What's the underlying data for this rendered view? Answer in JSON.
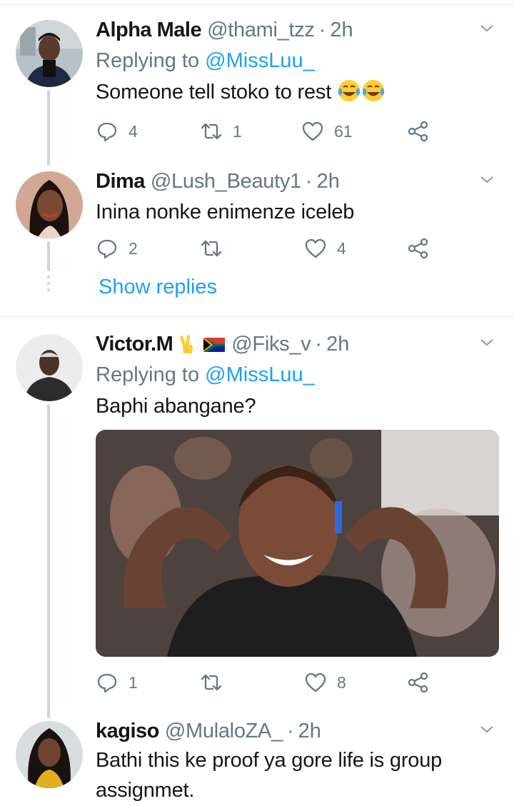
{
  "tweets": [
    {
      "name": "Alpha Male",
      "handle": "@thami_tzz",
      "time": "2h",
      "replying_label": "Replying to",
      "replying_mention": "@MissLuu_",
      "text": "Someone tell stoko to rest",
      "replies": "4",
      "retweets": "1",
      "likes": "61"
    },
    {
      "name": "Dima",
      "handle": "@Lush_Beauty1",
      "time": "2h",
      "text": "Inina nonke enimenze iceleb",
      "replies": "2",
      "retweets": "",
      "likes": "4",
      "show_replies": "Show replies"
    },
    {
      "name": "Victor.M",
      "handle": "@Fiks_v",
      "time": "2h",
      "replying_label": "Replying to",
      "replying_mention": "@MissLuu_",
      "text": "Baphi abangane?",
      "replies": "1",
      "retweets": "",
      "likes": "8"
    },
    {
      "name": "kagiso",
      "handle": "@MulaloZA_",
      "time": "2h",
      "text_line1": "Bathi this ke proof ya gore life is group",
      "text_line2": "assignmet."
    }
  ],
  "separator_dot": "·",
  "colors": {
    "accent": "#1da1f2",
    "secondary_text": "#657786",
    "divider": "#e1e8ed"
  }
}
